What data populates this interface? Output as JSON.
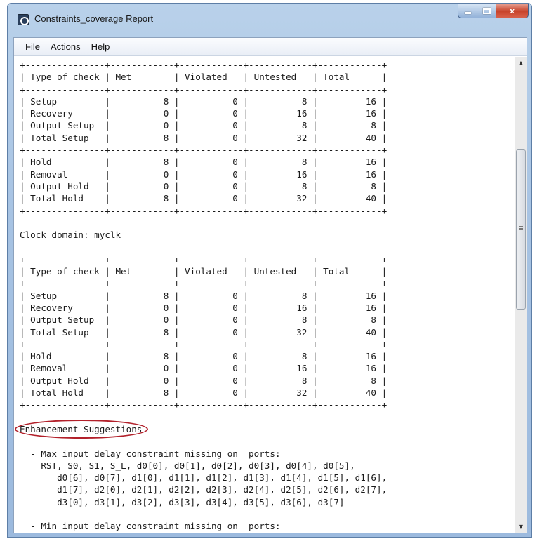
{
  "window": {
    "title": "Constraints_coverage Report",
    "app_icon": "report-app-icon",
    "controls": {
      "minimize_icon": "minimize-icon",
      "maximize_icon": "maximize-icon",
      "close_label": "x"
    }
  },
  "menu": {
    "items": [
      {
        "label": "File"
      },
      {
        "label": "Actions"
      },
      {
        "label": "Help"
      }
    ]
  },
  "report": {
    "top_text": "+---------------+------------+------------+------------+------------+\n| Type of check | Met        | Violated   | Untested   | Total      |\n+---------------+------------+------------+------------+------------+\n| Setup         |          8 |          0 |          8 |         16 |\n| Recovery      |          0 |          0 |         16 |         16 |\n| Output Setup  |          0 |          0 |          8 |          8 |\n| Total Setup   |          8 |          0 |         32 |         40 |\n+---------------+------------+------------+------------+------------+\n| Hold          |          8 |          0 |          8 |         16 |\n| Removal       |          0 |          0 |         16 |         16 |\n| Output Hold   |          0 |          0 |          8 |          8 |\n| Total Hold    |          8 |          0 |         32 |         40 |\n+---------------+------------+------------+------------+------------+\n\nClock domain: myclk\n\n+---------------+------------+------------+------------+------------+\n| Type of check | Met        | Violated   | Untested   | Total      |\n+---------------+------------+------------+------------+------------+\n| Setup         |          8 |          0 |          8 |         16 |\n| Recovery      |          0 |          0 |         16 |         16 |\n| Output Setup  |          0 |          0 |          8 |          8 |\n| Total Setup   |          8 |          0 |         32 |         40 |\n+---------------+------------+------------+------------+------------+\n| Hold          |          8 |          0 |          8 |         16 |\n| Removal       |          0 |          0 |         16 |         16 |\n| Output Hold   |          0 |          0 |          8 |          8 |\n| Total Hold    |          8 |          0 |         32 |         40 |\n+---------------+------------+------------+------------+------------+\n\n",
    "section_heading": "Enhancement Suggestions",
    "bottom_text": "\n\n  - Max input delay constraint missing on  ports:\n    RST, S0, S1, S_L, d0[0], d0[1], d0[2], d0[3], d0[4], d0[5],\n       d0[6], d0[7], d1[0], d1[1], d1[2], d1[3], d1[4], d1[5], d1[6],\n       d1[7], d2[0], d2[1], d2[2], d2[3], d2[4], d2[5], d2[6], d2[7],\n       d3[0], d3[1], d3[2], d3[3], d3[4], d3[5], d3[6], d3[7]\n\n  - Min input delay constraint missing on  ports:",
    "highlight_color": "#b2202a"
  },
  "scrollbar": {
    "up_icon": "scroll-up-arrow-icon",
    "down_icon": "scroll-down-arrow-icon"
  }
}
